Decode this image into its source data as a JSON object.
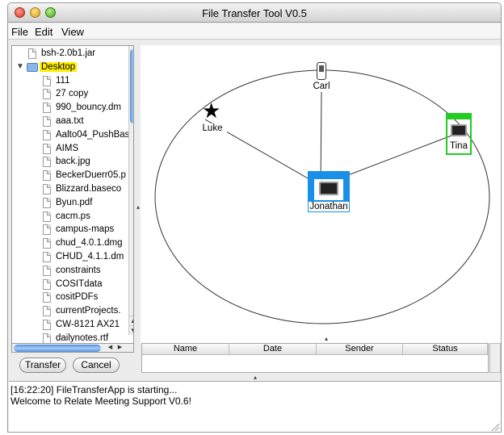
{
  "window": {
    "title": "File Transfer Tool V0.5"
  },
  "menu": {
    "file": "File",
    "edit": "Edit",
    "view": "View"
  },
  "tree": {
    "items": [
      {
        "label": "bsh-2.0b1.jar",
        "type": "file"
      },
      {
        "label": "Desktop",
        "type": "folder",
        "expanded": true,
        "highlighted": true
      },
      {
        "label": "111",
        "type": "file"
      },
      {
        "label": "27 copy",
        "type": "file"
      },
      {
        "label": "990_bouncy.dm",
        "type": "file"
      },
      {
        "label": "aaa.txt",
        "type": "file"
      },
      {
        "label": "Aalto04_PushBas",
        "type": "file"
      },
      {
        "label": "AIMS",
        "type": "file"
      },
      {
        "label": "back.jpg",
        "type": "file"
      },
      {
        "label": "BeckerDuerr05.p",
        "type": "file"
      },
      {
        "label": "Blizzard.baseco",
        "type": "file"
      },
      {
        "label": "Byun.pdf",
        "type": "file"
      },
      {
        "label": "cacm.ps",
        "type": "file"
      },
      {
        "label": "campus-maps",
        "type": "file"
      },
      {
        "label": "chud_4.0.1.dmg",
        "type": "file"
      },
      {
        "label": "CHUD_4.1.1.dm",
        "type": "file"
      },
      {
        "label": "constraints",
        "type": "file"
      },
      {
        "label": "COSITdata",
        "type": "file"
      },
      {
        "label": "cositPDFs",
        "type": "file"
      },
      {
        "label": "currentProjects.",
        "type": "file"
      },
      {
        "label": "CW-8121 AX21",
        "type": "file"
      },
      {
        "label": "dailynotes.rtf",
        "type": "file"
      }
    ]
  },
  "buttons": {
    "transfer": "Transfer",
    "cancel": "Cancel"
  },
  "graph": {
    "nodes": [
      {
        "id": "carl",
        "label": "Carl",
        "icon": "mobile-phone-icon"
      },
      {
        "id": "luke",
        "label": "Luke",
        "icon": "star-icon"
      },
      {
        "id": "tina",
        "label": "Tina",
        "icon": "monitor-icon",
        "accent": "#22cc22"
      },
      {
        "id": "jonathan",
        "label": "Jonathan",
        "icon": "monitor-icon",
        "accent": "#1a8fe8",
        "selected": true
      }
    ],
    "edges": [
      [
        "jonathan",
        "carl"
      ],
      [
        "jonathan",
        "luke"
      ],
      [
        "jonathan",
        "tina"
      ]
    ]
  },
  "transfers": {
    "columns": [
      "Name",
      "Date",
      "Sender",
      "Status"
    ],
    "rows": []
  },
  "log": {
    "lines": [
      "[16:22:20] FileTransferApp is  starting...",
      "Welcome to Relate Meeting Support V0.6!"
    ]
  },
  "colors": {
    "highlight": "#ffee00",
    "selected_node": "#1a8fe8",
    "tina_node": "#22cc22"
  }
}
